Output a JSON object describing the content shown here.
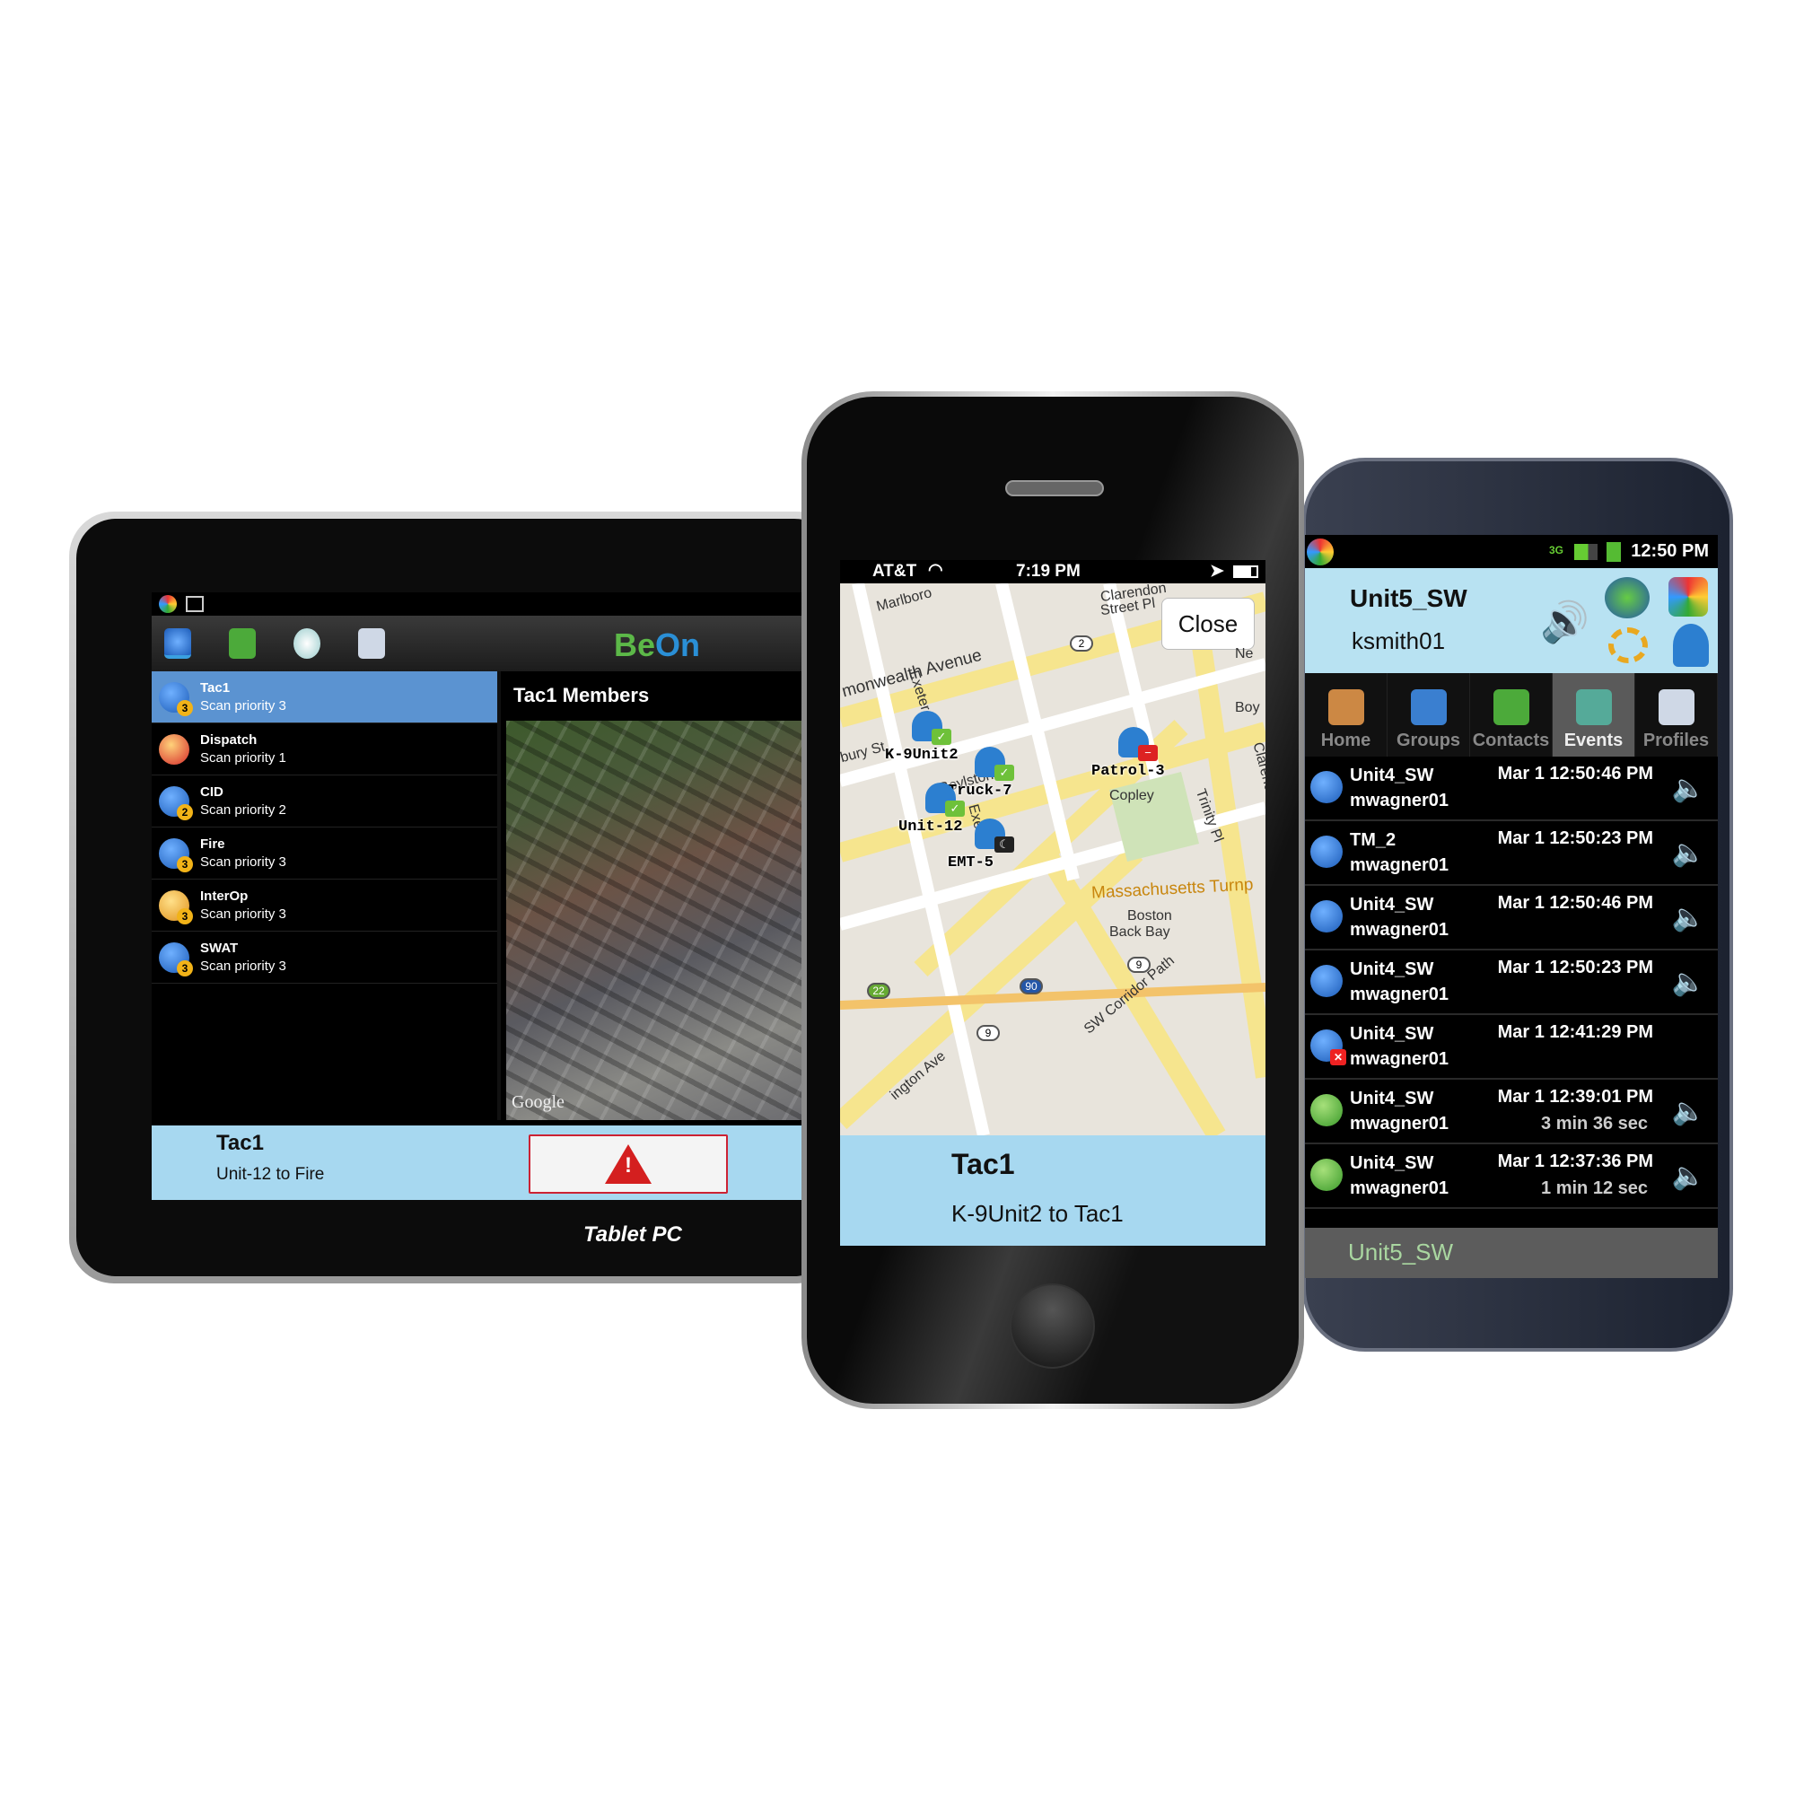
{
  "tablet": {
    "label": "Tablet PC",
    "logo": {
      "text_a": "Be",
      "text_b": "On"
    },
    "toolbar_icons": [
      "groups-icon",
      "contacts-icon",
      "history-icon",
      "profiles-icon"
    ],
    "groups": [
      {
        "name": "Tac1",
        "sub": "Scan priority 3",
        "badge": "3",
        "selected": true
      },
      {
        "name": "Dispatch",
        "sub": "Scan priority 1",
        "badge": "",
        "selected": false
      },
      {
        "name": "CID",
        "sub": "Scan priority 2",
        "badge": "2",
        "selected": false
      },
      {
        "name": "Fire",
        "sub": "Scan priority 3",
        "badge": "3",
        "selected": false
      },
      {
        "name": "InterOp",
        "sub": "Scan priority 3",
        "badge": "3",
        "selected": false
      },
      {
        "name": "SWAT",
        "sub": "Scan priority 3",
        "badge": "3",
        "selected": false
      }
    ],
    "members_title": "Tac1 Members",
    "map_attribution": "Google",
    "bottom": {
      "title": "Tac1",
      "subtitle": "Unit-12 to Fire",
      "alert_icon": "warning-icon"
    }
  },
  "iphone": {
    "status": {
      "carrier": "AT&T",
      "time": "7:19 PM"
    },
    "close_label": "Close",
    "streets": [
      "Marlboro",
      "Clarendon",
      "Street Pl",
      "monwealth Avenue",
      "Exeter St",
      "bury St",
      "Boylston St",
      "Ne",
      "Boy",
      "Clarendo",
      "Trinity Pl",
      "Copley",
      "Massachusetts Turnp",
      "Boston",
      "Back Bay",
      "SW Corridor Path",
      "ington Ave",
      "Exeter"
    ],
    "route_shields": [
      "2",
      "9",
      "9",
      "22",
      "90"
    ],
    "markers": [
      {
        "label": "K-9Unit2",
        "status": "check"
      },
      {
        "label": "Truck-7",
        "status": "check"
      },
      {
        "label": "Unit-12",
        "status": "check"
      },
      {
        "label": "EMT-5",
        "status": "moon"
      },
      {
        "label": "Patrol-3",
        "status": "busy"
      }
    ],
    "bottom": {
      "title": "Tac1",
      "subtitle": "K-9Unit2 to Tac1"
    }
  },
  "android": {
    "status": {
      "time": "12:50 PM",
      "network": "3G"
    },
    "header": {
      "name": "Unit5_SW",
      "user": "ksmith01"
    },
    "tabs": [
      {
        "label": "Home"
      },
      {
        "label": "Groups"
      },
      {
        "label": "Contacts"
      },
      {
        "label": "Events",
        "selected": true
      },
      {
        "label": "Profiles"
      }
    ],
    "events": [
      {
        "name": "Unit4_SW",
        "user": "mwagner01",
        "time": "Mar 1 12:50:46 PM",
        "duration": "",
        "icon": "blue",
        "audio": true
      },
      {
        "name": "TM_2",
        "user": "mwagner01",
        "time": "Mar 1 12:50:23 PM",
        "duration": "",
        "icon": "blue",
        "audio": true
      },
      {
        "name": "Unit4_SW",
        "user": "mwagner01",
        "time": "Mar 1 12:50:46 PM",
        "duration": "",
        "icon": "blue",
        "audio": true
      },
      {
        "name": "Unit4_SW",
        "user": "mwagner01",
        "time": "Mar 1 12:50:23 PM",
        "duration": "",
        "icon": "blue",
        "audio": true
      },
      {
        "name": "Unit4_SW",
        "user": "mwagner01",
        "time": "Mar 1 12:41:29 PM",
        "duration": "",
        "icon": "missed",
        "audio": false
      },
      {
        "name": "Unit4_SW",
        "user": "mwagner01",
        "time": "Mar 1 12:39:01 PM",
        "duration": "3 min 36 sec",
        "icon": "green",
        "audio": true
      },
      {
        "name": "Unit4_SW",
        "user": "mwagner01",
        "time": "Mar 1 12:37:36 PM",
        "duration": "1 min 12 sec",
        "icon": "green",
        "audio": true
      }
    ],
    "bottom": {
      "name": "Unit5_SW"
    }
  }
}
